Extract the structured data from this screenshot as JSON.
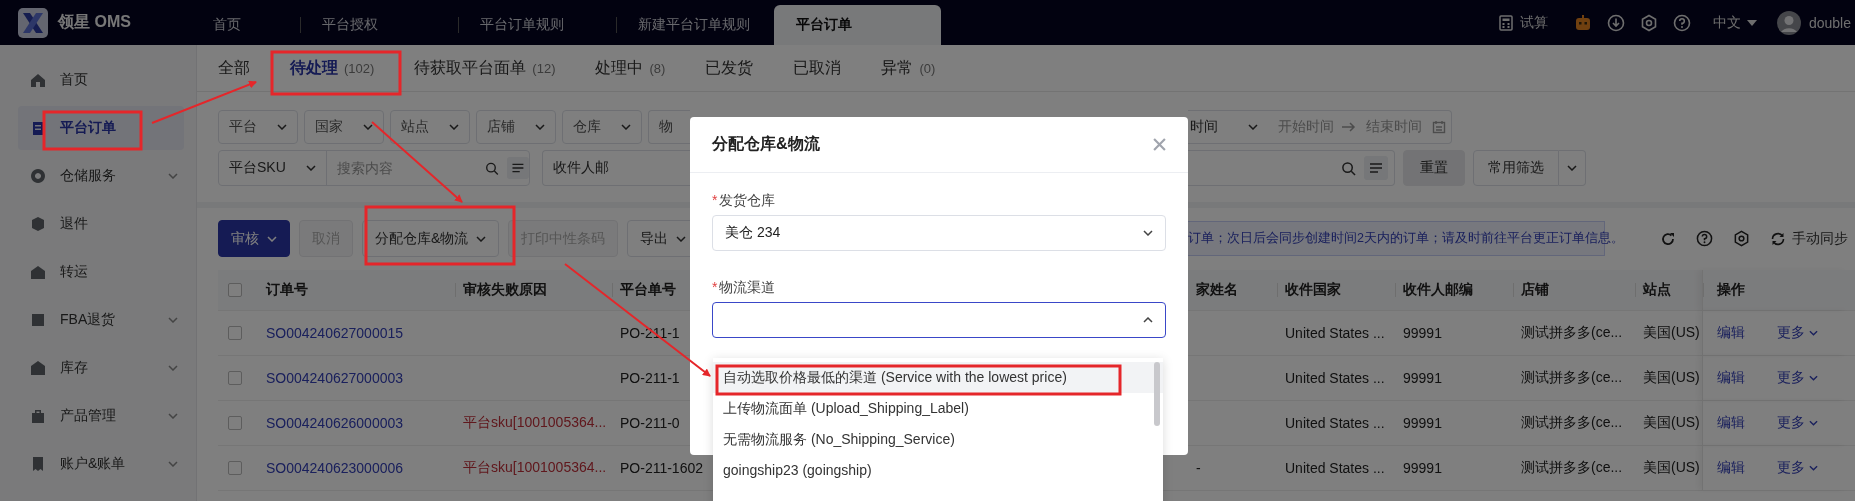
{
  "app": {
    "name": "领星 OMS"
  },
  "nav_tabs": [
    {
      "label": "首页",
      "selected": false
    },
    {
      "label": "平台授权",
      "selected": false
    },
    {
      "label": "平台订单规则",
      "selected": false
    },
    {
      "label": "新建平台订单规则",
      "selected": false
    },
    {
      "label": "平台订单",
      "selected": true
    }
  ],
  "header": {
    "calculator": "试算",
    "language": "中文",
    "user": "double"
  },
  "sidebar": [
    {
      "label": "首页",
      "selected": false,
      "expandable": false
    },
    {
      "label": "平台订单",
      "selected": true,
      "expandable": false
    },
    {
      "label": "仓储服务",
      "selected": false,
      "expandable": true
    },
    {
      "label": "退件",
      "selected": false,
      "expandable": false
    },
    {
      "label": "转运",
      "selected": false,
      "expandable": false
    },
    {
      "label": "FBA退货",
      "selected": false,
      "expandable": true
    },
    {
      "label": "库存",
      "selected": false,
      "expandable": true
    },
    {
      "label": "产品管理",
      "selected": false,
      "expandable": true
    },
    {
      "label": "账户&账单",
      "selected": false,
      "expandable": true
    }
  ],
  "status_tabs": [
    {
      "label": "全部",
      "selected": false
    },
    {
      "label": "待处理",
      "count": "(102)",
      "selected": true
    },
    {
      "label": "待获取平台面单",
      "count": "(12)",
      "selected": false
    },
    {
      "label": "处理中",
      "count": "(8)",
      "selected": false
    },
    {
      "label": "已发货",
      "selected": false
    },
    {
      "label": "已取消",
      "selected": false
    },
    {
      "label": "异常",
      "count": "(0)",
      "selected": false
    }
  ],
  "filters": {
    "selects": [
      "平台",
      "国家",
      "站点",
      "店铺",
      "仓库"
    ],
    "partial_select": "物",
    "time_select": "时间",
    "date_start": "开始时间",
    "date_end": "结束时间",
    "search_type": "平台SKU",
    "search_placeholder": "搜索内容",
    "recipient_select": "收件人邮",
    "reset": "重置",
    "saved_filters": "常用筛选"
  },
  "actions": [
    {
      "label": "审核",
      "kind": "primary",
      "disabled": false
    },
    {
      "label": "取消",
      "kind": "plain",
      "disabled": true
    },
    {
      "label": "分配仓库&物流",
      "kind": "dropdown",
      "disabled": false
    },
    {
      "label": "打印中性条码",
      "kind": "plain",
      "disabled": true
    },
    {
      "label": "导出",
      "kind": "dropdown",
      "disabled": false
    }
  ],
  "notice": "订单；次日后会同步创建时间2天内的订单；请及时前往平台更正订单信息。",
  "sync": "手动同步",
  "table": {
    "header_checked": false,
    "columns": [
      "订单号",
      "审核失败原因",
      "平台单号",
      "家姓名",
      "收件国家",
      "收件人邮编",
      "店铺",
      "站点",
      "操作"
    ],
    "rows": [
      {
        "checked": false,
        "order_no": "SO004240627000015",
        "platform_no": "PO-211-1",
        "country": "United States ...",
        "zip": "99991",
        "store": "测试拼多多(ce...",
        "site": "美国(US)",
        "edit": "编辑",
        "more": "更多"
      },
      {
        "checked": false,
        "order_no": "SO004240627000003",
        "platform_no": "PO-211-1",
        "country": "United States ...",
        "zip": "99991",
        "store": "测试拼多多(ce...",
        "site": "美国(US)",
        "edit": "编辑",
        "more": "更多"
      },
      {
        "checked": false,
        "order_no": "SO004240626000003",
        "fail_reason": "平台sku[1001005364...",
        "platform_no": "PO-211-0",
        "country": "United States ...",
        "zip": "99991",
        "store": "测试拼多多(ce...",
        "site": "美国(US)",
        "edit": "编辑",
        "more": "更多"
      },
      {
        "checked": false,
        "order_no": "SO004240623000006",
        "fail_reason": "平台sku[1001005364...",
        "platform_no": "PO-211-1602",
        "recipient": "-",
        "country": "United States ...",
        "zip": "99991",
        "store": "测试拼多多(ce...",
        "site": "美国(US)",
        "edit": "编辑",
        "more": "更多"
      }
    ]
  },
  "modal": {
    "title": "分配仓库&物流",
    "fields": [
      {
        "mark": "*",
        "label": "发货仓库",
        "value": "美仓 234",
        "focused": false,
        "expanded": false
      },
      {
        "mark": "*",
        "label": "物流渠道",
        "focused": true,
        "expanded": true
      }
    ],
    "options": [
      {
        "label": "自动选取价格最低的渠道 (Service with the lowest price)",
        "hovered": true
      },
      {
        "label": "上传物流面单 (Upload_Shipping_Label)",
        "hovered": false
      },
      {
        "label": "无需物流服务 (No_Shipping_Service)",
        "hovered": false
      },
      {
        "label": "goingship23 (goingship)",
        "hovered": false
      }
    ]
  }
}
